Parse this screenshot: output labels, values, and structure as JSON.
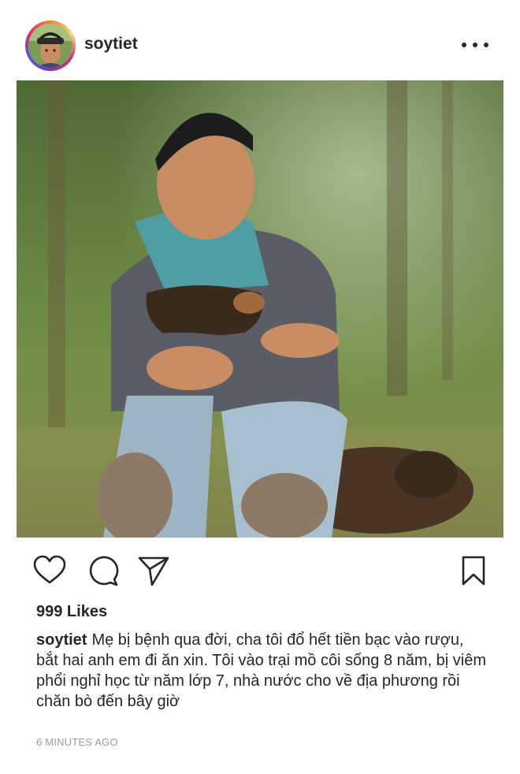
{
  "post": {
    "username": "soytiet",
    "more_icon": "more-horizontal-icon",
    "likes": "999 Likes",
    "caption_user": "soytiet",
    "caption_text": "Mẹ bị bệnh qua đời, cha tôi đổ hết tiền bạc vào rượu, bắt hai anh em đi ăn xin. Tôi vào trại mồ côi sống 8 năm, bị viêm phổi nghỉ học từ năm lớp 7, nhà nước cho về địa phương rồi chăn bò đến bây giờ",
    "timestamp": "6 MINUTES AGO"
  },
  "actions": {
    "like_icon": "heart-icon",
    "comment_icon": "comment-icon",
    "share_icon": "send-icon",
    "save_icon": "bookmark-icon"
  },
  "colors": {
    "text": "#262626",
    "muted": "#9a9a9a",
    "ring_gradient": [
      "#f58529",
      "#feda77",
      "#dd2a7b",
      "#8134af",
      "#515bd4"
    ]
  }
}
